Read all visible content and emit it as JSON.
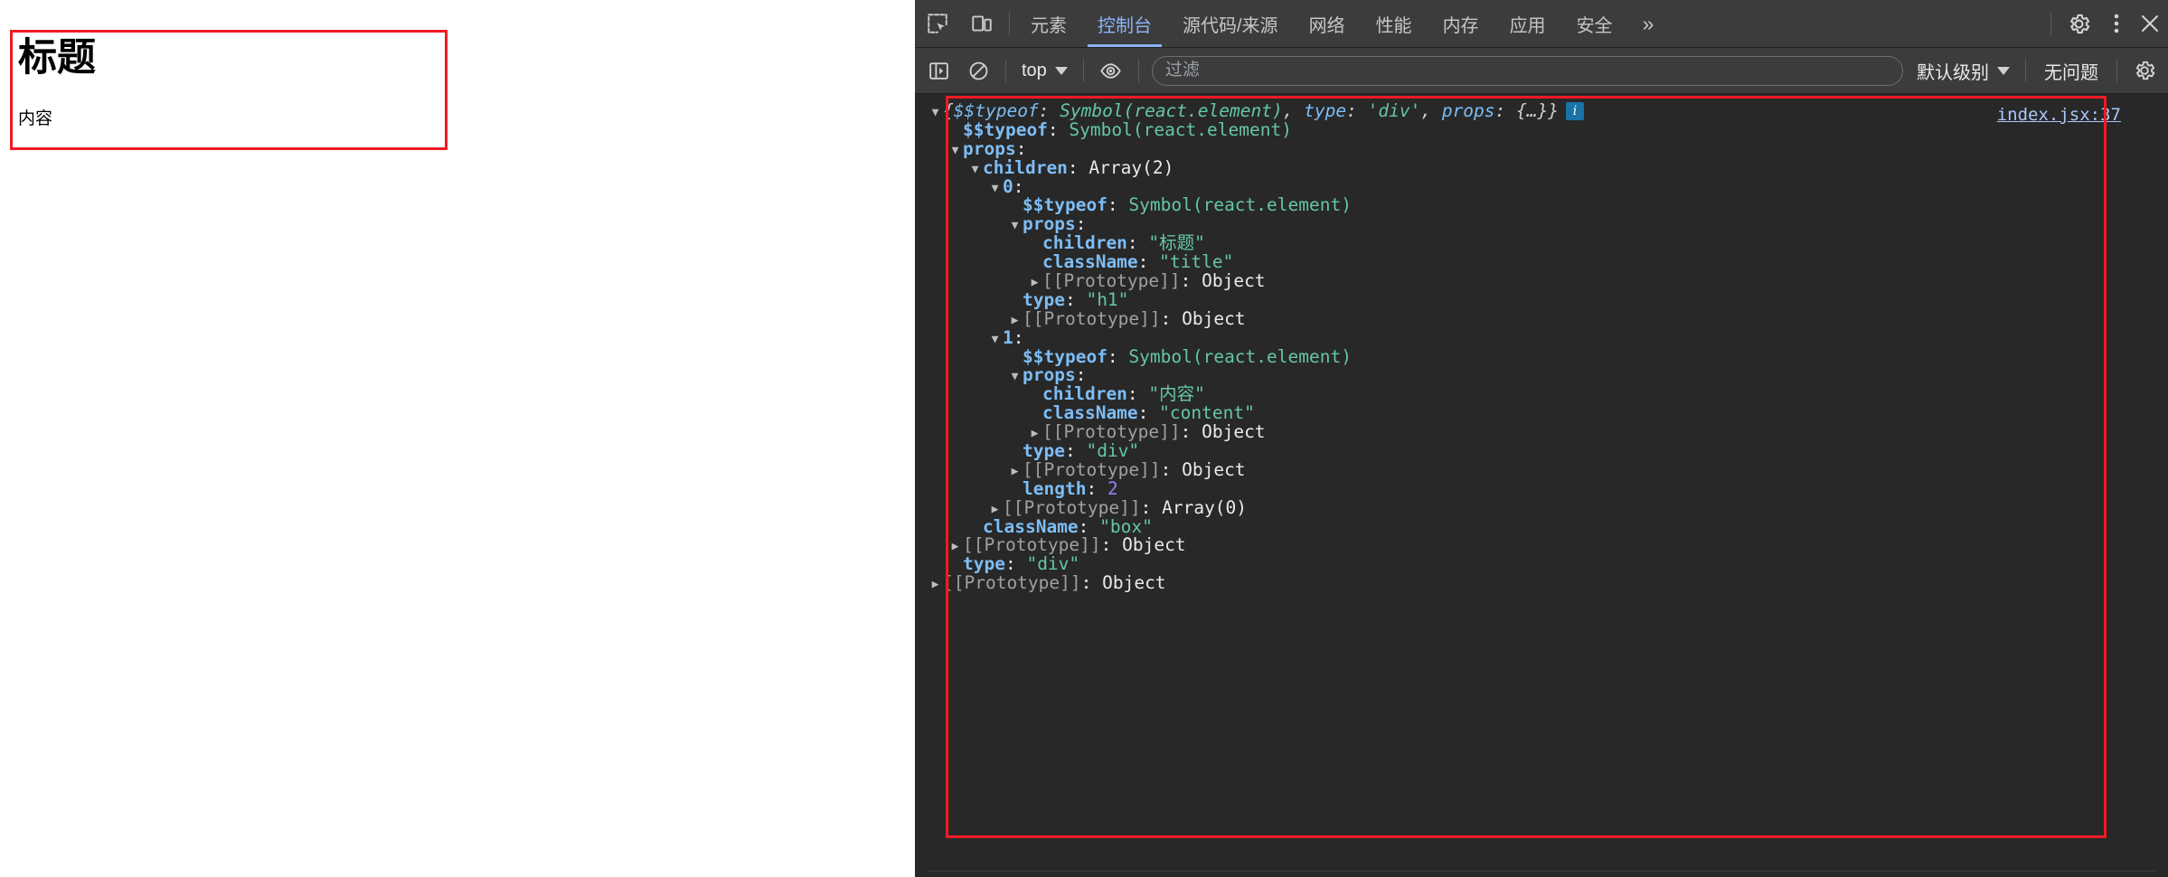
{
  "page": {
    "title": "标题",
    "content": "内容",
    "highlight_color": "#ee1b24"
  },
  "devtools": {
    "accent_color": "#8ab4f8",
    "toolbar": {
      "inspect_icon": "inspect-element-icon",
      "device_icon": "device-toolbar-icon",
      "tabs": [
        {
          "label": "元素",
          "active": false
        },
        {
          "label": "控制台",
          "active": true
        },
        {
          "label": "源代码/来源",
          "active": false
        },
        {
          "label": "网络",
          "active": false
        },
        {
          "label": "性能",
          "active": false
        },
        {
          "label": "内存",
          "active": false
        },
        {
          "label": "应用",
          "active": false
        },
        {
          "label": "安全",
          "active": false
        }
      ],
      "more_tabs_label": "»",
      "settings_icon": "gear-icon",
      "menu_icon": "kebab-menu-icon",
      "close_icon": "close-icon"
    },
    "console_toolbar": {
      "sidebar_icon": "console-sidebar-icon",
      "clear_icon": "clear-console-icon",
      "context_value": "top",
      "eye_icon": "live-expression-icon",
      "filter_placeholder": "过滤",
      "filter_value": "",
      "level_value": "默认级别",
      "issues_label": "无问题",
      "console_settings_icon": "gear-icon"
    },
    "console": {
      "source_link": "index.jsx:37",
      "info_badge": "i",
      "highlight_color": "#ee1b24",
      "preview": {
        "open": "{",
        "k1": "$$typeof",
        "v1": "Symbol(react.element)",
        "k2": "type",
        "v2": "'div'",
        "k3": "props",
        "v3": "{…}",
        "close": "}"
      },
      "rows": [
        {
          "indent": 0,
          "arrow": "down",
          "key": "",
          "keyclass": "preview",
          "sep": "",
          "value": "",
          "valclass": "preview",
          "is_preview": true
        },
        {
          "indent": 1,
          "arrow": "none",
          "key": "$$typeof",
          "keyclass": "prop",
          "sep": ": ",
          "value": "Symbol(react.element)",
          "valclass": "str"
        },
        {
          "indent": 1,
          "arrow": "down",
          "key": "props",
          "keyclass": "prop",
          "sep": ":",
          "value": "",
          "valclass": "plain"
        },
        {
          "indent": 2,
          "arrow": "down",
          "key": "children",
          "keyclass": "prop",
          "sep": ": ",
          "value": "Array(2)",
          "valclass": "plain"
        },
        {
          "indent": 3,
          "arrow": "down",
          "key": "0",
          "keyclass": "prop",
          "sep": ":",
          "value": "",
          "valclass": "plain"
        },
        {
          "indent": 4,
          "arrow": "none",
          "key": "$$typeof",
          "keyclass": "prop",
          "sep": ": ",
          "value": "Symbol(react.element)",
          "valclass": "str"
        },
        {
          "indent": 4,
          "arrow": "down",
          "key": "props",
          "keyclass": "prop",
          "sep": ":",
          "value": "",
          "valclass": "plain"
        },
        {
          "indent": 5,
          "arrow": "none",
          "key": "children",
          "keyclass": "prop",
          "sep": ": ",
          "value": "\"标题\"",
          "valclass": "str"
        },
        {
          "indent": 5,
          "arrow": "none",
          "key": "className",
          "keyclass": "prop",
          "sep": ": ",
          "value": "\"title\"",
          "valclass": "str"
        },
        {
          "indent": 5,
          "arrow": "right",
          "key": "[[Prototype]]",
          "keyclass": "propd",
          "sep": ": ",
          "value": "Object",
          "valclass": "plain"
        },
        {
          "indent": 4,
          "arrow": "none",
          "key": "type",
          "keyclass": "prop",
          "sep": ": ",
          "value": "\"h1\"",
          "valclass": "str"
        },
        {
          "indent": 4,
          "arrow": "right",
          "key": "[[Prototype]]",
          "keyclass": "propd",
          "sep": ": ",
          "value": "Object",
          "valclass": "plain"
        },
        {
          "indent": 3,
          "arrow": "down",
          "key": "1",
          "keyclass": "prop",
          "sep": ":",
          "value": "",
          "valclass": "plain"
        },
        {
          "indent": 4,
          "arrow": "none",
          "key": "$$typeof",
          "keyclass": "prop",
          "sep": ": ",
          "value": "Symbol(react.element)",
          "valclass": "str"
        },
        {
          "indent": 4,
          "arrow": "down",
          "key": "props",
          "keyclass": "prop",
          "sep": ":",
          "value": "",
          "valclass": "plain"
        },
        {
          "indent": 5,
          "arrow": "none",
          "key": "children",
          "keyclass": "prop",
          "sep": ": ",
          "value": "\"内容\"",
          "valclass": "str"
        },
        {
          "indent": 5,
          "arrow": "none",
          "key": "className",
          "keyclass": "prop",
          "sep": ": ",
          "value": "\"content\"",
          "valclass": "str"
        },
        {
          "indent": 5,
          "arrow": "right",
          "key": "[[Prototype]]",
          "keyclass": "propd",
          "sep": ": ",
          "value": "Object",
          "valclass": "plain"
        },
        {
          "indent": 4,
          "arrow": "none",
          "key": "type",
          "keyclass": "prop",
          "sep": ": ",
          "value": "\"div\"",
          "valclass": "str"
        },
        {
          "indent": 4,
          "arrow": "right",
          "key": "[[Prototype]]",
          "keyclass": "propd",
          "sep": ": ",
          "value": "Object",
          "valclass": "plain"
        },
        {
          "indent": 4,
          "arrow": "none",
          "key": "length",
          "keyclass": "prop",
          "sep": ": ",
          "value": "2",
          "valclass": "num"
        },
        {
          "indent": 3,
          "arrow": "right",
          "key": "[[Prototype]]",
          "keyclass": "propd",
          "sep": ": ",
          "value": "Array(0)",
          "valclass": "plain"
        },
        {
          "indent": 2,
          "arrow": "none",
          "key": "className",
          "keyclass": "prop",
          "sep": ": ",
          "value": "\"box\"",
          "valclass": "str"
        },
        {
          "indent": 1,
          "arrow": "right",
          "key": "[[Prototype]]",
          "keyclass": "propd",
          "sep": ": ",
          "value": "Object",
          "valclass": "plain"
        },
        {
          "indent": 1,
          "arrow": "none",
          "key": "type",
          "keyclass": "prop",
          "sep": ": ",
          "value": "\"div\"",
          "valclass": "str"
        },
        {
          "indent": 0,
          "arrow": "right",
          "key": "[[Prototype]]",
          "keyclass": "propd",
          "sep": ": ",
          "value": "Object",
          "valclass": "plain"
        }
      ]
    }
  }
}
